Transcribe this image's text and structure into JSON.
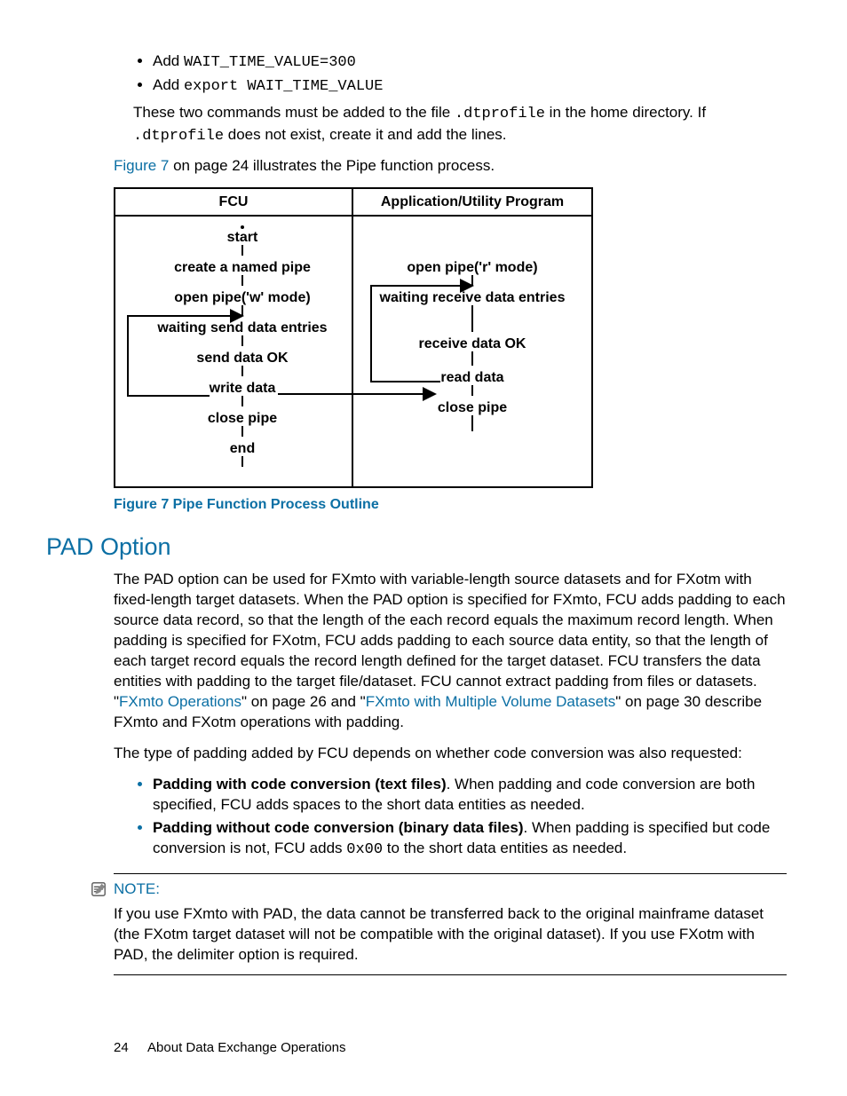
{
  "commands": {
    "prefix": "Add ",
    "items": [
      "WAIT_TIME_VALUE=300",
      "export WAIT_TIME_VALUE"
    ]
  },
  "command_note": {
    "pre": "These two commands must be added to the file ",
    "code1": ".dtprofile",
    "mid": " in the home directory. If ",
    "code2": ".dtprofile",
    "post": " does not exist, create it and add the lines."
  },
  "fig_ref": {
    "link": "Figure 7",
    "rest": " on page 24 illustrates the Pipe function process."
  },
  "diagram": {
    "headers": [
      "FCU",
      "Application/Utility Program"
    ],
    "left": [
      "start",
      "create a named pipe",
      "open pipe('w' mode)",
      "waiting send data entries",
      "send data OK",
      "write data",
      "close pipe",
      "end"
    ],
    "right": [
      "open pipe('r' mode)",
      "waiting receive data entries",
      "receive data OK",
      "read data",
      "close pipe"
    ]
  },
  "figure_caption": "Figure 7 Pipe Function Process Outline",
  "pad": {
    "heading": "PAD Option",
    "para1_a": "The PAD option can be used for FXmto with variable-length source datasets and for FXotm with fixed-length target datasets. When the PAD option is specified for FXmto, FCU adds padding to each source data record, so that the length of the each record equals the maximum record length. When padding is specified for FXotm, FCU adds padding to each source data entity, so that the length of each target record equals the record length defined for the target dataset. FCU transfers the data entities with padding to the target file/dataset. FCU cannot extract padding from files or datasets. \"",
    "link1": "FXmto Operations",
    "para1_b": "\" on page 26 and \"",
    "link2": "FXmto with Multiple Volume Datasets",
    "para1_c": "\" on page 30 describe FXmto and FXotm operations with padding.",
    "para2": "The type of padding added by FCU depends on whether code conversion was also requested:",
    "bullets": [
      {
        "bold": "Padding with code conversion (text files)",
        "text": ". When padding and code conversion are both specified, FCU adds spaces to the short data entities as needed."
      },
      {
        "bold": "Padding without code conversion (binary data files)",
        "text_a": ". When padding is specified but code conversion is not, FCU adds ",
        "code": "0x00",
        "text_b": " to the short data entities as needed."
      }
    ]
  },
  "note": {
    "label": "NOTE:",
    "body": "If you use FXmto with PAD, the data cannot be transferred back to the original mainframe dataset (the FXotm target dataset will not be compatible with the original dataset). If you use FXotm with PAD, the delimiter option is required."
  },
  "footer": {
    "page": "24",
    "title": "About Data Exchange Operations"
  }
}
